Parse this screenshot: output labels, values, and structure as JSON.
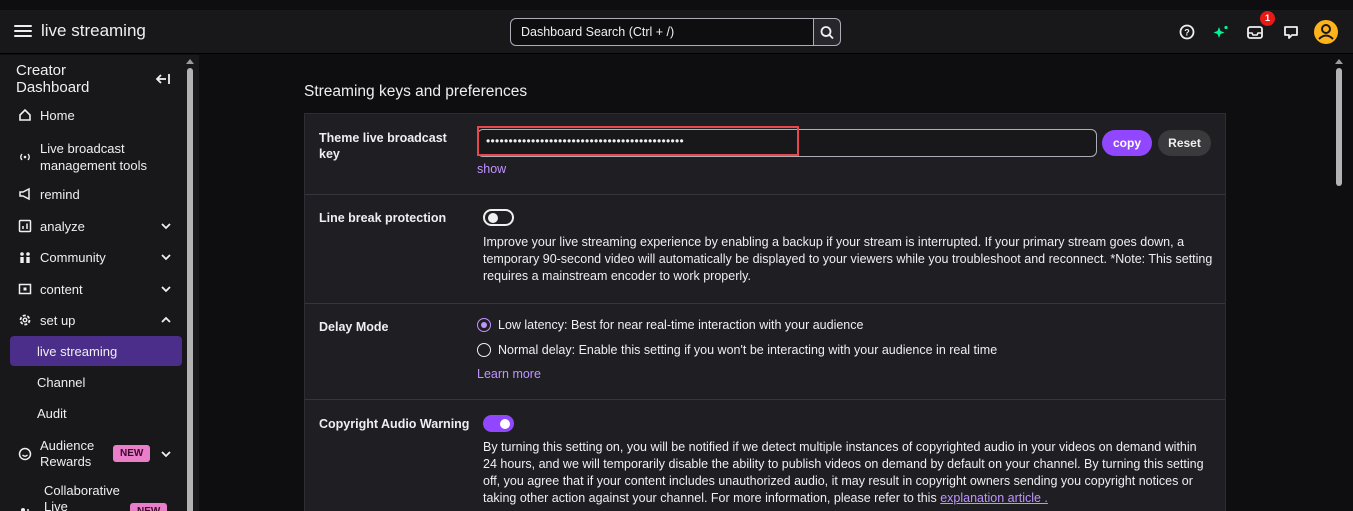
{
  "topbar": {
    "title": "live streaming",
    "search_placeholder": "Dashboard Search (Ctrl + /)",
    "notification_count": "1"
  },
  "sidebar": {
    "header": "Creator Dashboard",
    "header_line1": "Creator",
    "header_line2": "Dashboard",
    "items": [
      {
        "label": "Home",
        "icon": "home-icon"
      },
      {
        "label_line1": "Live broadcast",
        "label_line2": "management tools",
        "icon": "broadcast-icon"
      },
      {
        "label": "remind",
        "icon": "megaphone-icon"
      },
      {
        "label": "analyze",
        "icon": "chart-icon"
      },
      {
        "label": "Community",
        "icon": "community-icon"
      },
      {
        "label": "content",
        "icon": "content-icon"
      },
      {
        "label": "set up",
        "icon": "gear-icon"
      }
    ],
    "setup_sub": [
      "live streaming",
      "Channel",
      "Audit"
    ],
    "audience_rewards_line1": "Audience",
    "audience_rewards_line2": "Rewards",
    "collab_line1": "Collaborative",
    "collab_line2": "Live",
    "new_badge": "NEW"
  },
  "main": {
    "heading": "Streaming keys and preferences",
    "key_row": {
      "label_line1": "Theme live broadcast",
      "label_line2": "key",
      "masked_value": "••••••••••••••••••••••••••••••••••••••••••••",
      "copy_label": "copy",
      "reset_label": "Reset",
      "show_label": "show"
    },
    "line_break": {
      "label": "Line break protection",
      "enabled": false,
      "description": "Improve your live streaming experience by enabling a backup if your stream is interrupted. If your primary stream goes down, a temporary 90-second video will automatically be displayed to your viewers while you troubleshoot and reconnect. *Note: This setting requires a mainstream encoder to work properly."
    },
    "delay_mode": {
      "label": "Delay Mode",
      "option_low": "Low latency: Best for near real-time interaction with your audience",
      "option_normal": "Normal delay: Enable this setting if you won't be interacting with your audience in real time",
      "selected": "low",
      "learn_more": "Learn more"
    },
    "copyright": {
      "label": "Copyright Audio Warning",
      "enabled": true,
      "description": "By turning this setting on, you will be notified if we detect multiple instances of copyrighted audio in your videos on demand within 24 hours, and we will temporarily disable the ability to publish videos on demand by default on your channel. By turning this setting off, you agree that if your content includes unauthorized audio, it may result in copyright owners sending you copyright notices or taking other action against your channel. For more information, please refer to this",
      "link_text": "explanation article ."
    }
  },
  "colors": {
    "accent": "#9147ff",
    "link": "#bf94ff",
    "highlight": "#e5484d",
    "background": "#0e0e10"
  }
}
